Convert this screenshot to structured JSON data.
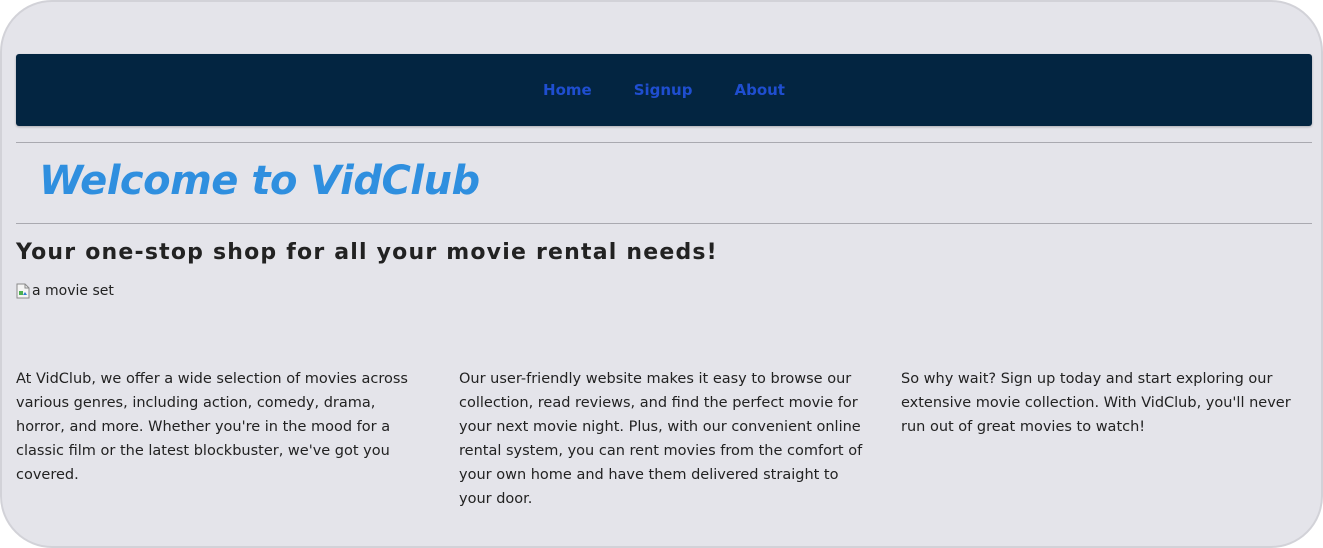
{
  "nav": {
    "items": [
      {
        "label": "Home"
      },
      {
        "label": "Signup"
      },
      {
        "label": "About"
      }
    ]
  },
  "hero": {
    "title": "Welcome to VidClub",
    "tagline": "Your one-stop shop for all your movie rental needs!",
    "image_alt": "a movie set"
  },
  "content": {
    "columns": [
      {
        "text": "At VidClub, we offer a wide selection of movies across various genres, including action, comedy, drama, horror, and more. Whether you're in the mood for a classic film or the latest blockbuster, we've got you covered."
      },
      {
        "text": "Our user-friendly website makes it easy to browse our collection, read reviews, and find the perfect movie for your next movie night. Plus, with our convenient online rental system, you can rent movies from the comfort of your own home and have them delivered straight to your door."
      },
      {
        "text": "So why wait? Sign up today and start exploring our extensive movie collection. With VidClub, you'll never run out of great movies to watch!"
      }
    ]
  },
  "colors": {
    "navbar_bg": "#032541",
    "nav_link": "#1f4ed0",
    "title": "#2f8fdf",
    "page_bg": "#e4e4ea",
    "text": "#222222"
  }
}
